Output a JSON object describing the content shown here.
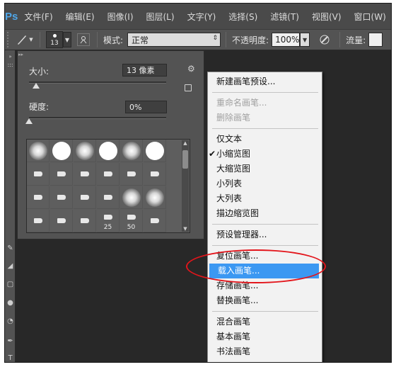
{
  "app": {
    "logo": "Ps",
    "accent": "#4fa6e8"
  },
  "menu_bar": [
    "文件(F)",
    "编辑(E)",
    "图像(I)",
    "图层(L)",
    "文字(Y)",
    "选择(S)",
    "滤镜(T)",
    "视图(V)",
    "窗口(W)"
  ],
  "options_bar": {
    "brush_size": "13",
    "mode_label": "模式:",
    "mode_value": "正常",
    "opacity_label": "不透明度:",
    "opacity_value": "100%",
    "flow_label": "流量:"
  },
  "brush_panel": {
    "size_label": "大小:",
    "size_value": "13 像素",
    "size_slider_value": 0.05,
    "hardness_label": "硬度:",
    "hardness_value": "0%",
    "hardness_slider_value": 0,
    "presets": [
      {
        "kind": "soft",
        "label": ""
      },
      {
        "kind": "hard",
        "label": ""
      },
      {
        "kind": "soft",
        "label": ""
      },
      {
        "kind": "hard",
        "label": ""
      },
      {
        "kind": "soft",
        "label": ""
      },
      {
        "kind": "hard",
        "label": ""
      },
      {
        "kind": "tip",
        "label": ""
      },
      {
        "kind": "tip",
        "label": ""
      },
      {
        "kind": "tip",
        "label": ""
      },
      {
        "kind": "tip",
        "label": ""
      },
      {
        "kind": "tip",
        "label": ""
      },
      {
        "kind": "tip",
        "label": ""
      },
      {
        "kind": "tip",
        "label": ""
      },
      {
        "kind": "tip",
        "label": ""
      },
      {
        "kind": "tip",
        "label": ""
      },
      {
        "kind": "tip",
        "label": ""
      },
      {
        "kind": "soft",
        "label": ""
      },
      {
        "kind": "soft",
        "label": ""
      },
      {
        "kind": "tip",
        "label": ""
      },
      {
        "kind": "tip",
        "label": ""
      },
      {
        "kind": "tip",
        "label": ""
      },
      {
        "kind": "tip",
        "label": "25"
      },
      {
        "kind": "tip",
        "label": "50"
      },
      {
        "kind": "tip",
        "label": ""
      }
    ]
  },
  "context_menu": {
    "items": [
      {
        "label": "新建画笔预设...",
        "state": "normal"
      },
      {
        "sep": true
      },
      {
        "label": "重命名画笔...",
        "state": "disabled"
      },
      {
        "label": "删除画笔",
        "state": "disabled"
      },
      {
        "sep": true
      },
      {
        "label": "仅文本",
        "state": "normal"
      },
      {
        "label": "小缩览图",
        "state": "checked"
      },
      {
        "label": "大缩览图",
        "state": "normal"
      },
      {
        "label": "小列表",
        "state": "normal"
      },
      {
        "label": "大列表",
        "state": "normal"
      },
      {
        "label": "描边缩览图",
        "state": "normal"
      },
      {
        "sep": true
      },
      {
        "label": "预设管理器...",
        "state": "normal"
      },
      {
        "sep": true
      },
      {
        "label": "复位画笔...",
        "state": "normal"
      },
      {
        "label": "载入画笔...",
        "state": "highlighted"
      },
      {
        "label": "存储画笔...",
        "state": "normal"
      },
      {
        "label": "替换画笔...",
        "state": "normal"
      },
      {
        "sep": true
      },
      {
        "label": "混合画笔",
        "state": "normal"
      },
      {
        "label": "基本画笔",
        "state": "normal"
      },
      {
        "label": "书法画笔",
        "state": "normal"
      }
    ],
    "check_glyph": "✔",
    "highlight_color": "#3b98f2"
  },
  "annotation": {
    "color": "#e3151b"
  }
}
